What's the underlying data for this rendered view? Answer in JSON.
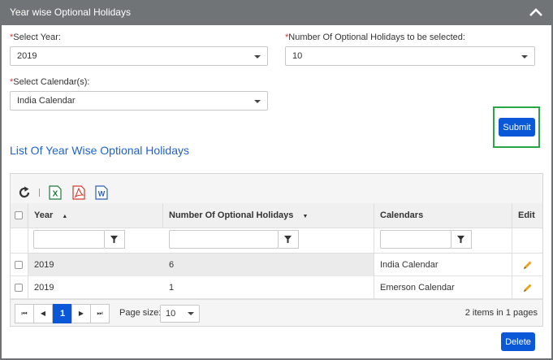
{
  "panel": {
    "title": "Year wise Optional Holidays"
  },
  "form": {
    "year_label": "Select Year:",
    "year_value": "2019",
    "count_label": "Number Of Optional Holidays to be selected:",
    "count_value": "10",
    "calendar_label": "Select Calendar(s):",
    "calendar_value": "India Calendar",
    "required_mark": "*",
    "submit_label": "Submit"
  },
  "list": {
    "title": "List Of Year Wise Optional Holidays",
    "columns": [
      "Year",
      "Number Of Optional Holidays",
      "Calendars",
      "Edit"
    ],
    "rows": [
      {
        "year": "2019",
        "count": "6",
        "calendar": "India Calendar"
      },
      {
        "year": "2019",
        "count": "1",
        "calendar": "Emerson Calendar"
      }
    ]
  },
  "toolbar": {
    "icons": [
      "refresh-icon",
      "excel-icon",
      "pdf-icon",
      "word-icon"
    ],
    "excel_letter": "X",
    "word_letter": "W"
  },
  "pager": {
    "current_page": "1",
    "page_size_label": "Page size:",
    "page_size": "10",
    "info": "2 items in 1 pages",
    "first": "⏮",
    "prev": "◀",
    "next": "▶",
    "last": "⏭"
  },
  "actions": {
    "delete_label": "Delete"
  },
  "colors": {
    "header_bg": "#717477",
    "primary": "#0a58d8",
    "title_blue": "#1e62d0",
    "highlight_green": "#27a844",
    "required_red": "#d9302c"
  }
}
